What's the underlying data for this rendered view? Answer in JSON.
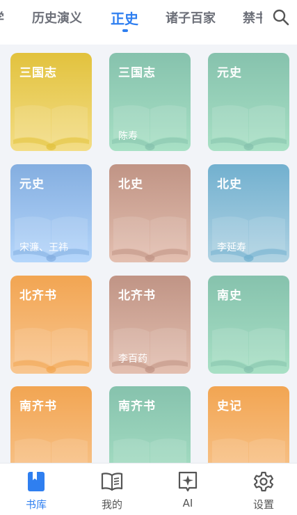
{
  "tabs": {
    "partial": "学",
    "items": [
      "历史演义",
      "正史",
      "诸子百家",
      "禁书"
    ]
  },
  "cards": [
    {
      "title": "三国志",
      "author": "",
      "color_top": "#e2c23d",
      "color_bottom": "#f3dd86"
    },
    {
      "title": "三国志",
      "author": "陈寿",
      "color_top": "#86c2ad",
      "color_bottom": "#a8e0c5"
    },
    {
      "title": "元史",
      "author": "",
      "color_top": "#86c2ad",
      "color_bottom": "#a8e0c5"
    },
    {
      "title": "元史",
      "author": "宋濂、王祎",
      "color_top": "#84aee0",
      "color_bottom": "#b5d6fb"
    },
    {
      "title": "北史",
      "author": "",
      "color_top": "#c09485",
      "color_bottom": "#e3bfb0"
    },
    {
      "title": "北史",
      "author": "李延寿",
      "color_top": "#72b0cf",
      "color_bottom": "#b0d3e3"
    },
    {
      "title": "北齐书",
      "author": "",
      "color_top": "#f2a552",
      "color_bottom": "#f8c690"
    },
    {
      "title": "北齐书",
      "author": "李百药",
      "color_top": "#c09485",
      "color_bottom": "#e3bfb0"
    },
    {
      "title": "南史",
      "author": "",
      "color_top": "#86c2ad",
      "color_bottom": "#a8e0c5"
    },
    {
      "title": "南齐书",
      "author": "",
      "color_top": "#f2a552",
      "color_bottom": "#f8c690"
    },
    {
      "title": "南齐书",
      "author": "",
      "color_top": "#86c2ad",
      "color_bottom": "#a8e0c5"
    },
    {
      "title": "史记",
      "author": "",
      "color_top": "#f2a552",
      "color_bottom": "#f8c690"
    }
  ],
  "nav": [
    {
      "label": "书库",
      "icon": "bookmark-book-icon"
    },
    {
      "label": "我的",
      "icon": "open-book-icon"
    },
    {
      "label": "AI",
      "icon": "ai-sparkle-icon"
    },
    {
      "label": "设置",
      "icon": "gear-icon"
    }
  ],
  "colors": {
    "accent": "#2f7ff0"
  }
}
